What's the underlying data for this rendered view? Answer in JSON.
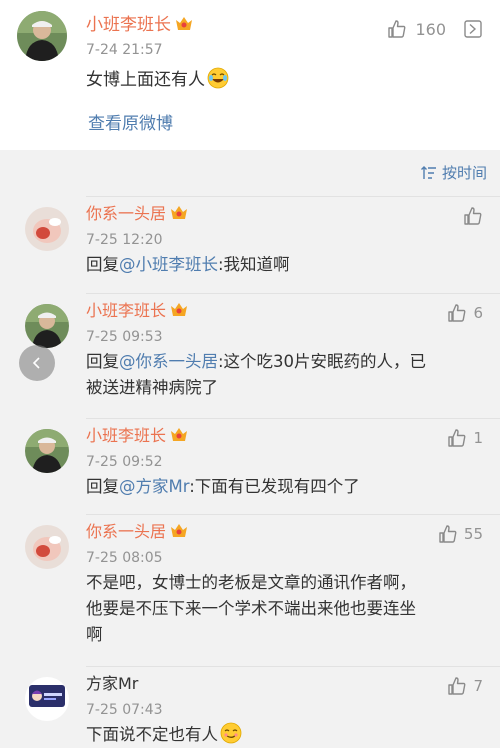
{
  "root_comment": {
    "username": "小班李班长",
    "time": "7-24 21:57",
    "likes": "160",
    "text": "女博上面还有人",
    "view_original": "查看原微博"
  },
  "sort": {
    "label": "按时间"
  },
  "replies": [
    {
      "username": "你系一头居",
      "time": "7-25 12:20",
      "likes": "",
      "prefix": "回复",
      "mention": "@小班李班长",
      "text": ":我知道啊"
    },
    {
      "username": "小班李班长",
      "time": "7-25 09:53",
      "likes": "6",
      "prefix": "回复",
      "mention": "@你系一头居",
      "text_line1": ":这个吃30片安眠药的人，已",
      "text_line2": "被送进精神病院了"
    },
    {
      "username": "小班李班长",
      "time": "7-25 09:52",
      "likes": "1",
      "prefix": "回复",
      "mention": "@方家Mr",
      "text": ":下面有已发现有四个了"
    },
    {
      "username": "你系一头居",
      "time": "7-25 08:05",
      "likes": "55",
      "text_line1": "不是吧，女博士的老板是文章的通讯作者啊，",
      "text_line2": "他要是不压下来一个学术不端出来他也要连坐",
      "text_line3": "啊"
    },
    {
      "username": "方家Mr",
      "time": "7-25 07:43",
      "likes": "7",
      "text": "下面说不定也有人"
    }
  ],
  "colors": {
    "username": "#eb7350",
    "link": "#507daf",
    "meta": "#939393",
    "background_gray": "#f2f2f2"
  },
  "icons": [
    "thumb-up-icon",
    "more-icon",
    "sort-icon",
    "vip-badge-icon",
    "crying-laughing-emoji",
    "smirk-emoji",
    "back-arrow-icon"
  ]
}
